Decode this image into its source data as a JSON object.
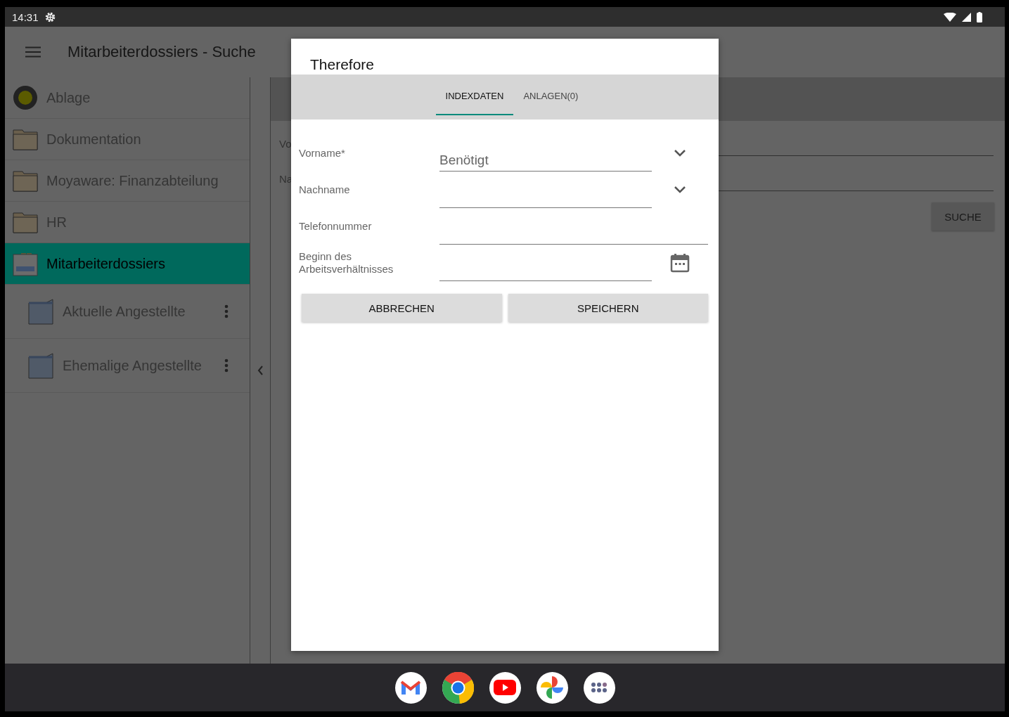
{
  "status_bar": {
    "time": "14:31"
  },
  "toolbar": {
    "title": "Mitarbeiterdossiers - Suche"
  },
  "sidebar": {
    "items": [
      {
        "label": "Ablage",
        "kind": "archive",
        "selected": false
      },
      {
        "label": "Dokumentation",
        "kind": "folder",
        "selected": false
      },
      {
        "label": "Moyaware: Finanzabteilung",
        "kind": "folder",
        "selected": false
      },
      {
        "label": "HR",
        "kind": "folder",
        "selected": false
      },
      {
        "label": "Mitarbeiterdossiers",
        "kind": "cabinet",
        "selected": true,
        "children": [
          {
            "label": "Aktuelle Angestellte",
            "kind": "subfolder",
            "selected": false
          },
          {
            "label": "Ehemalige Angestellte",
            "kind": "subfolder",
            "selected": false
          }
        ]
      }
    ]
  },
  "search_form": {
    "fields": [
      {
        "label": "Vo"
      },
      {
        "label": "Na"
      }
    ],
    "button": "SUCHE"
  },
  "dialog": {
    "title": "Therefore",
    "tabs": [
      {
        "label": "INDEXDATEN",
        "selected": true
      },
      {
        "label": "ANLAGEN(0)",
        "selected": false
      }
    ],
    "fields": [
      {
        "label": "Vorname*",
        "placeholder": "Benötigt",
        "kind": "dropdown"
      },
      {
        "label": "Nachname",
        "kind": "dropdown"
      },
      {
        "label": "Telefonnummer",
        "kind": "text"
      },
      {
        "label": "Beginn des Arbeitsverhältnisses",
        "kind": "date"
      }
    ],
    "buttons": [
      "ABBRECHEN",
      "SPEICHERN"
    ]
  },
  "dock": {
    "apps": [
      {
        "kind": "mail"
      },
      {
        "kind": "browser"
      },
      {
        "kind": "video"
      },
      {
        "kind": "photos"
      },
      {
        "kind": "launcher"
      }
    ]
  }
}
